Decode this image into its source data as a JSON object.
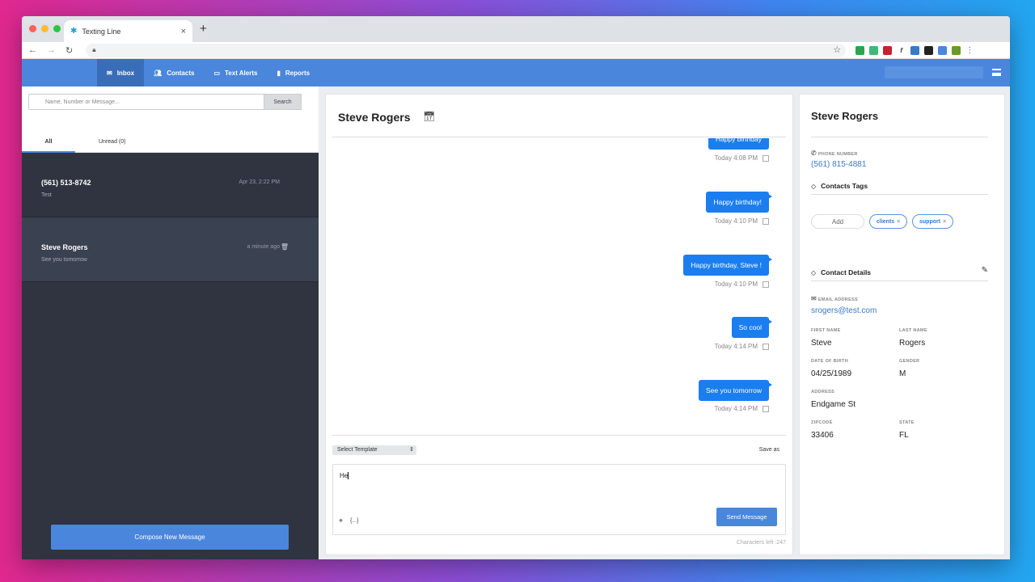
{
  "browser": {
    "tab_title": "Texting Line",
    "new_tab": "+",
    "close": "×"
  },
  "nav": {
    "items": [
      {
        "label": "Inbox"
      },
      {
        "label": "Contacts"
      },
      {
        "label": "Text Alerts"
      },
      {
        "label": "Reports"
      }
    ]
  },
  "left": {
    "search_placeholder": "Name, Number or Message...",
    "search_button": "Search",
    "tabs": {
      "all": "All",
      "unread": "Unread (0)"
    },
    "conversations": [
      {
        "name": "(561) 513-8742",
        "preview": "Test",
        "date": "Apr 23, 2:22 PM"
      },
      {
        "name": "Steve Rogers",
        "preview": "See you tomorrow",
        "date": "a minute ago"
      }
    ],
    "compose_button": "Compose New Message"
  },
  "chat": {
    "title": "Steve Rogers",
    "messages": [
      {
        "text": "Happy birthday",
        "time": "Today 4:08 PM"
      },
      {
        "text": "Happy birthday!",
        "time": "Today 4:10 PM"
      },
      {
        "text": "Happy birthday, Steve !",
        "time": "Today 4:10 PM"
      },
      {
        "text": "So cool",
        "time": "Today 4:14 PM"
      },
      {
        "text": "See you tomorrow",
        "time": "Today 4:14 PM"
      }
    ],
    "template_select": "Select Template",
    "save_as": "Save as",
    "draft": "He",
    "variables": "{...}",
    "send_button": "Send Message",
    "chars_left": "Characters left :247"
  },
  "contact": {
    "name": "Steve Rogers",
    "phone_label": "PHONE NUMBER",
    "phone": "(561) 815-4881",
    "tags_label": "Contacts Tags",
    "add_tag": "Add",
    "tags": [
      "clients",
      "support"
    ],
    "details_label": "Contact Details",
    "email_label": "EMAIL ADDRESS",
    "email": "srogers@test.com",
    "first_name_label": "FIRST NAME",
    "first_name": "Steve",
    "last_name_label": "LAST NAME",
    "last_name": "Rogers",
    "dob_label": "DATE OF BIRTH",
    "dob": "04/25/1989",
    "gender_label": "GENDER",
    "gender": "M",
    "address_label": "ADDRESS",
    "address": "Endgame St",
    "zip_label": "ZIPCODE",
    "zip": "33406",
    "state_label": "STATE",
    "state": "FL"
  },
  "colors": {
    "brand": "#4a86dc",
    "bubble": "#1a7ef0",
    "sidebar": "#2f3440"
  }
}
